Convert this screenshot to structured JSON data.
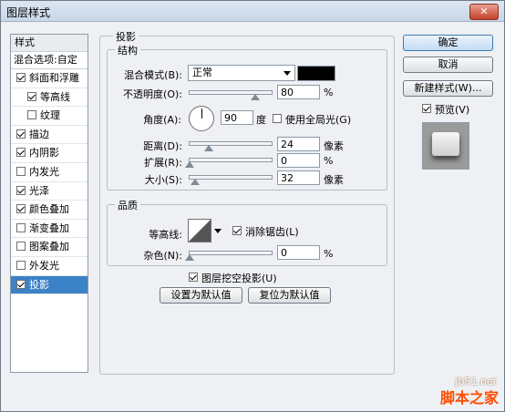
{
  "window": {
    "title": "图层样式",
    "close_label": "✕"
  },
  "left_panel": {
    "header": "样式",
    "blend_options": "混合选项:自定",
    "items": [
      {
        "label": "斜面和浮雕",
        "checked": true,
        "indent": false,
        "selected": false
      },
      {
        "label": "等高线",
        "checked": true,
        "indent": true,
        "selected": false
      },
      {
        "label": "纹理",
        "checked": false,
        "indent": true,
        "selected": false
      },
      {
        "label": "描边",
        "checked": true,
        "indent": false,
        "selected": false
      },
      {
        "label": "内阴影",
        "checked": true,
        "indent": false,
        "selected": false
      },
      {
        "label": "内发光",
        "checked": false,
        "indent": false,
        "selected": false
      },
      {
        "label": "光泽",
        "checked": true,
        "indent": false,
        "selected": false
      },
      {
        "label": "颜色叠加",
        "checked": true,
        "indent": false,
        "selected": false
      },
      {
        "label": "渐变叠加",
        "checked": false,
        "indent": false,
        "selected": false
      },
      {
        "label": "图案叠加",
        "checked": false,
        "indent": false,
        "selected": false
      },
      {
        "label": "外发光",
        "checked": false,
        "indent": false,
        "selected": false
      },
      {
        "label": "投影",
        "checked": true,
        "indent": false,
        "selected": true
      }
    ]
  },
  "drop_shadow": {
    "title": "投影",
    "structure": {
      "title": "结构",
      "blend_mode_label": "混合模式(B):",
      "blend_mode_value": "正常",
      "shadow_color": "#000000",
      "opacity_label": "不透明度(O):",
      "opacity_value": "80",
      "opacity_level": 0.8,
      "percent": "%",
      "angle_label": "角度(A):",
      "angle_value": "90",
      "degree": "度",
      "global_light_label": "使用全局光(G)",
      "global_light_checked": false,
      "distance_label": "距离(D):",
      "distance_value": "24",
      "spread_label": "扩展(R):",
      "spread_value": "0",
      "size_label": "大小(S):",
      "size_value": "32",
      "pixels": "像素"
    },
    "quality": {
      "title": "品质",
      "contour_label": "等高线:",
      "anti_alias_label": "消除锯齿(L)",
      "anti_alias_checked": true,
      "noise_label": "杂色(N):",
      "noise_value": "0",
      "percent": "%"
    },
    "knockout_label": "图层挖空投影(U)",
    "knockout_checked": true,
    "make_default_label": "设置为默认值",
    "reset_default_label": "复位为默认值"
  },
  "right_panel": {
    "ok_label": "确定",
    "cancel_label": "取消",
    "new_style_label": "新建样式(W)...",
    "preview_label": "预览(V)",
    "preview_checked": true
  },
  "watermark": {
    "line1": "jb51.net",
    "line2": "脚本之家"
  }
}
